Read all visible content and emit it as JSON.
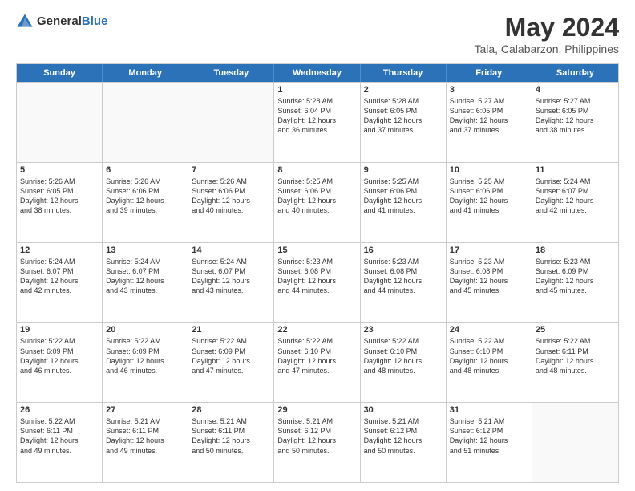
{
  "header": {
    "logo_general": "General",
    "logo_blue": "Blue",
    "title": "May 2024",
    "subtitle": "Tala, Calabarzon, Philippines"
  },
  "calendar": {
    "days": [
      "Sunday",
      "Monday",
      "Tuesday",
      "Wednesday",
      "Thursday",
      "Friday",
      "Saturday"
    ],
    "rows": [
      [
        {
          "day": "",
          "content": ""
        },
        {
          "day": "",
          "content": ""
        },
        {
          "day": "",
          "content": ""
        },
        {
          "day": "1",
          "content": "Sunrise: 5:28 AM\nSunset: 6:04 PM\nDaylight: 12 hours\nand 36 minutes."
        },
        {
          "day": "2",
          "content": "Sunrise: 5:28 AM\nSunset: 6:05 PM\nDaylight: 12 hours\nand 37 minutes."
        },
        {
          "day": "3",
          "content": "Sunrise: 5:27 AM\nSunset: 6:05 PM\nDaylight: 12 hours\nand 37 minutes."
        },
        {
          "day": "4",
          "content": "Sunrise: 5:27 AM\nSunset: 6:05 PM\nDaylight: 12 hours\nand 38 minutes."
        }
      ],
      [
        {
          "day": "5",
          "content": "Sunrise: 5:26 AM\nSunset: 6:05 PM\nDaylight: 12 hours\nand 38 minutes."
        },
        {
          "day": "6",
          "content": "Sunrise: 5:26 AM\nSunset: 6:06 PM\nDaylight: 12 hours\nand 39 minutes."
        },
        {
          "day": "7",
          "content": "Sunrise: 5:26 AM\nSunset: 6:06 PM\nDaylight: 12 hours\nand 40 minutes."
        },
        {
          "day": "8",
          "content": "Sunrise: 5:25 AM\nSunset: 6:06 PM\nDaylight: 12 hours\nand 40 minutes."
        },
        {
          "day": "9",
          "content": "Sunrise: 5:25 AM\nSunset: 6:06 PM\nDaylight: 12 hours\nand 41 minutes."
        },
        {
          "day": "10",
          "content": "Sunrise: 5:25 AM\nSunset: 6:06 PM\nDaylight: 12 hours\nand 41 minutes."
        },
        {
          "day": "11",
          "content": "Sunrise: 5:24 AM\nSunset: 6:07 PM\nDaylight: 12 hours\nand 42 minutes."
        }
      ],
      [
        {
          "day": "12",
          "content": "Sunrise: 5:24 AM\nSunset: 6:07 PM\nDaylight: 12 hours\nand 42 minutes."
        },
        {
          "day": "13",
          "content": "Sunrise: 5:24 AM\nSunset: 6:07 PM\nDaylight: 12 hours\nand 43 minutes."
        },
        {
          "day": "14",
          "content": "Sunrise: 5:24 AM\nSunset: 6:07 PM\nDaylight: 12 hours\nand 43 minutes."
        },
        {
          "day": "15",
          "content": "Sunrise: 5:23 AM\nSunset: 6:08 PM\nDaylight: 12 hours\nand 44 minutes."
        },
        {
          "day": "16",
          "content": "Sunrise: 5:23 AM\nSunset: 6:08 PM\nDaylight: 12 hours\nand 44 minutes."
        },
        {
          "day": "17",
          "content": "Sunrise: 5:23 AM\nSunset: 6:08 PM\nDaylight: 12 hours\nand 45 minutes."
        },
        {
          "day": "18",
          "content": "Sunrise: 5:23 AM\nSunset: 6:09 PM\nDaylight: 12 hours\nand 45 minutes."
        }
      ],
      [
        {
          "day": "19",
          "content": "Sunrise: 5:22 AM\nSunset: 6:09 PM\nDaylight: 12 hours\nand 46 minutes."
        },
        {
          "day": "20",
          "content": "Sunrise: 5:22 AM\nSunset: 6:09 PM\nDaylight: 12 hours\nand 46 minutes."
        },
        {
          "day": "21",
          "content": "Sunrise: 5:22 AM\nSunset: 6:09 PM\nDaylight: 12 hours\nand 47 minutes."
        },
        {
          "day": "22",
          "content": "Sunrise: 5:22 AM\nSunset: 6:10 PM\nDaylight: 12 hours\nand 47 minutes."
        },
        {
          "day": "23",
          "content": "Sunrise: 5:22 AM\nSunset: 6:10 PM\nDaylight: 12 hours\nand 48 minutes."
        },
        {
          "day": "24",
          "content": "Sunrise: 5:22 AM\nSunset: 6:10 PM\nDaylight: 12 hours\nand 48 minutes."
        },
        {
          "day": "25",
          "content": "Sunrise: 5:22 AM\nSunset: 6:11 PM\nDaylight: 12 hours\nand 48 minutes."
        }
      ],
      [
        {
          "day": "26",
          "content": "Sunrise: 5:22 AM\nSunset: 6:11 PM\nDaylight: 12 hours\nand 49 minutes."
        },
        {
          "day": "27",
          "content": "Sunrise: 5:21 AM\nSunset: 6:11 PM\nDaylight: 12 hours\nand 49 minutes."
        },
        {
          "day": "28",
          "content": "Sunrise: 5:21 AM\nSunset: 6:11 PM\nDaylight: 12 hours\nand 50 minutes."
        },
        {
          "day": "29",
          "content": "Sunrise: 5:21 AM\nSunset: 6:12 PM\nDaylight: 12 hours\nand 50 minutes."
        },
        {
          "day": "30",
          "content": "Sunrise: 5:21 AM\nSunset: 6:12 PM\nDaylight: 12 hours\nand 50 minutes."
        },
        {
          "day": "31",
          "content": "Sunrise: 5:21 AM\nSunset: 6:12 PM\nDaylight: 12 hours\nand 51 minutes."
        },
        {
          "day": "",
          "content": ""
        }
      ]
    ]
  }
}
